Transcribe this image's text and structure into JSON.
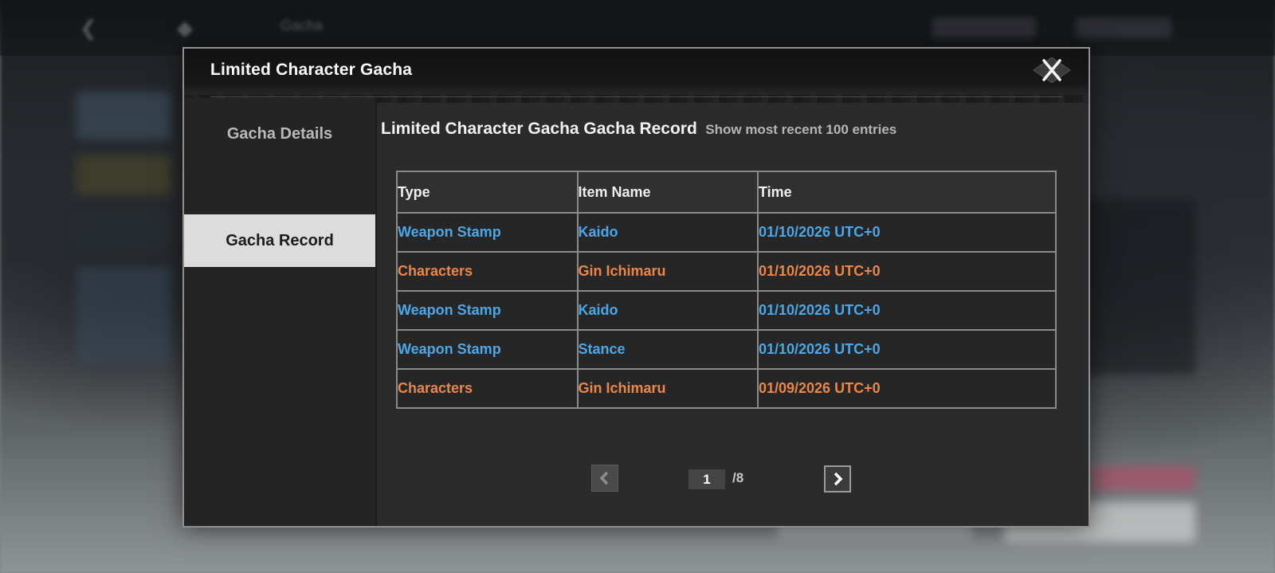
{
  "modal": {
    "title": "Limited Character Gacha",
    "close_icon": "close-icon"
  },
  "sidebar": {
    "items": [
      {
        "label": "Gacha Details",
        "active": false
      },
      {
        "label": "Gacha Record",
        "active": true
      }
    ]
  },
  "record": {
    "title": "Limited Character Gacha Gacha Record",
    "subtitle": "Show most recent 100 entries",
    "columns": [
      "Type",
      "Item Name",
      "Time"
    ],
    "rows": [
      {
        "type": "Weapon Stamp",
        "name": "Kaido",
        "time": "01/10/2026 UTC+0",
        "color": "#4aa7e8"
      },
      {
        "type": "Characters",
        "name": "Gin Ichimaru",
        "time": "01/10/2026 UTC+0",
        "color": "#e8874a"
      },
      {
        "type": "Weapon Stamp",
        "name": "Kaido",
        "time": "01/10/2026 UTC+0",
        "color": "#4aa7e8"
      },
      {
        "type": "Weapon Stamp",
        "name": "Stance",
        "time": "01/10/2026 UTC+0",
        "color": "#4aa7e8"
      },
      {
        "type": "Characters",
        "name": "Gin Ichimaru",
        "time": "01/09/2026 UTC+0",
        "color": "#e8874a"
      }
    ]
  },
  "pagination": {
    "current": "1",
    "total": "/8",
    "prev_icon": "chevron-left-icon",
    "next_icon": "chevron-right-icon"
  },
  "background": {
    "top_label": "Gacha"
  },
  "colors": {
    "weapon": "#4aa7e8",
    "character": "#e8874a",
    "active_tab": "#dcdcdc"
  }
}
